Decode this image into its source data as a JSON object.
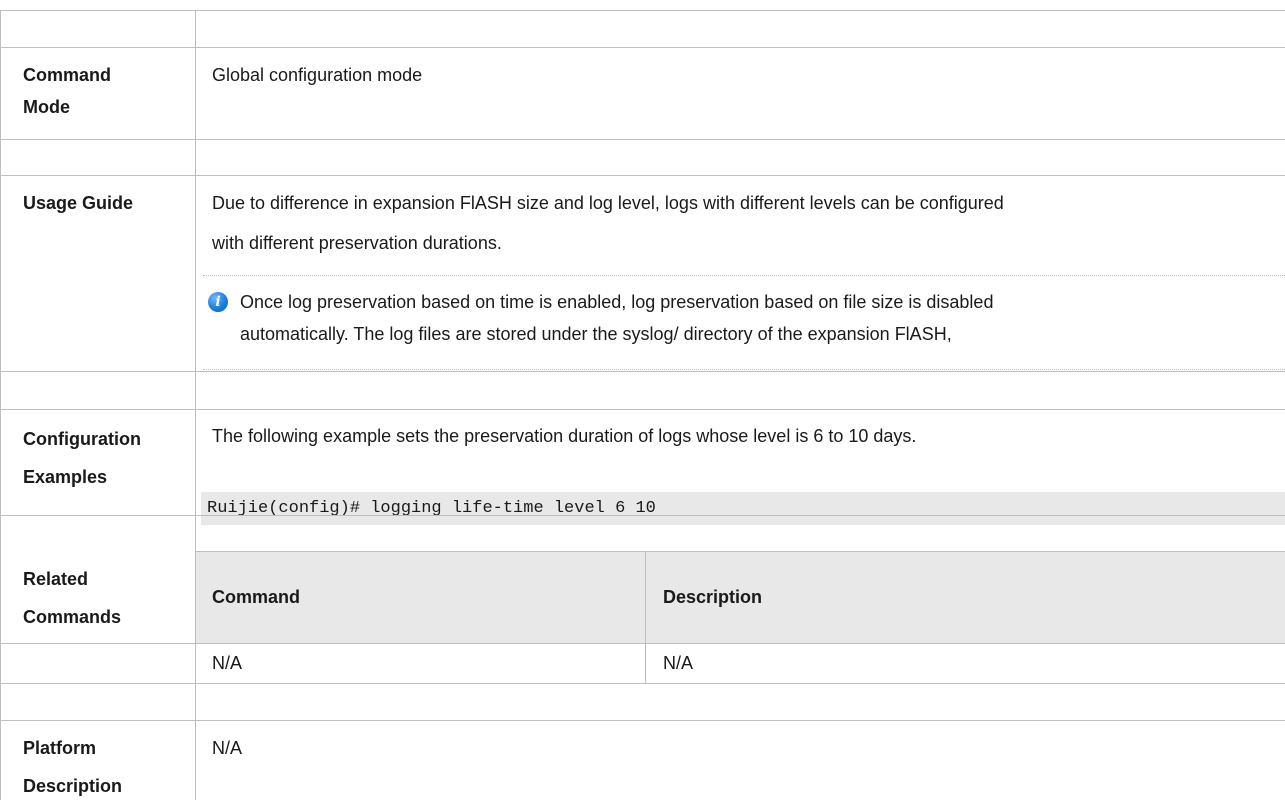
{
  "sections": {
    "command_mode": {
      "label_line1": "Command",
      "label_line2": "Mode",
      "value": "Global configuration mode"
    },
    "usage_guide": {
      "label": "Usage Guide",
      "para_line1": "Due to difference in expansion FlASH size and log level, logs with different levels can be configured",
      "para_line2": "with different preservation durations.",
      "note_icon": "info-icon",
      "note_line1": "Once log preservation based on time is enabled, log preservation based on file size is disabled",
      "note_line2": "automatically. The log files are stored under the syslog/ directory of the expansion FlASH,"
    },
    "configuration_examples": {
      "label_line1": "Configuration",
      "label_line2": "Examples",
      "description": "The following example sets the preservation duration of logs whose level is 6 to 10 days.",
      "code": "Ruijie(config)# logging life-time level 6 10"
    },
    "related_commands": {
      "label_line1": "Related",
      "label_line2": "Commands",
      "headers": [
        "Command",
        "Description"
      ],
      "rows": [
        [
          "N/A",
          "N/A"
        ]
      ]
    },
    "platform_description": {
      "label_line1": "Platform",
      "label_line2": "Description",
      "value": "N/A"
    }
  },
  "colors": {
    "border": "#bdbdbd",
    "header_fill": "#e8e8e8",
    "code_fill": "#e8e8e8",
    "icon_blue": "#1c7fe0"
  }
}
